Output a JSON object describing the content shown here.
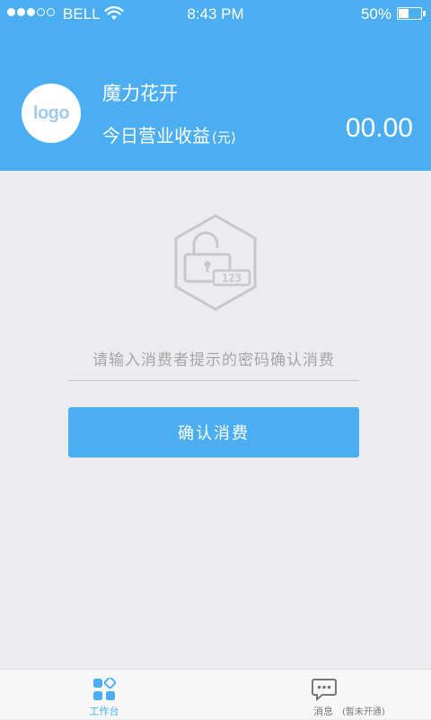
{
  "status_bar": {
    "carrier": "BELL",
    "time": "8:43 PM",
    "battery": "50%",
    "battery_level": 0.5
  },
  "header": {
    "avatar_text": "logo",
    "shop_name": "魔力花开",
    "income_label": "今日营业收益",
    "income_unit": "(元)",
    "income_value": "00.00"
  },
  "main": {
    "lock_code_digits": "123",
    "input_placeholder": "请输入消费者提示的密码确认消费",
    "input_value": "",
    "confirm_label": "确认消费"
  },
  "tab_bar": {
    "tabs": [
      {
        "label": "工作台",
        "icon": "workbench-icon",
        "active": true
      },
      {
        "label": "消息",
        "note": "(暂未开通)",
        "icon": "message-icon",
        "active": false
      }
    ]
  },
  "colors": {
    "accent": "#4aaef0",
    "background": "#ececee",
    "placeholder": "#a6a6a8"
  }
}
